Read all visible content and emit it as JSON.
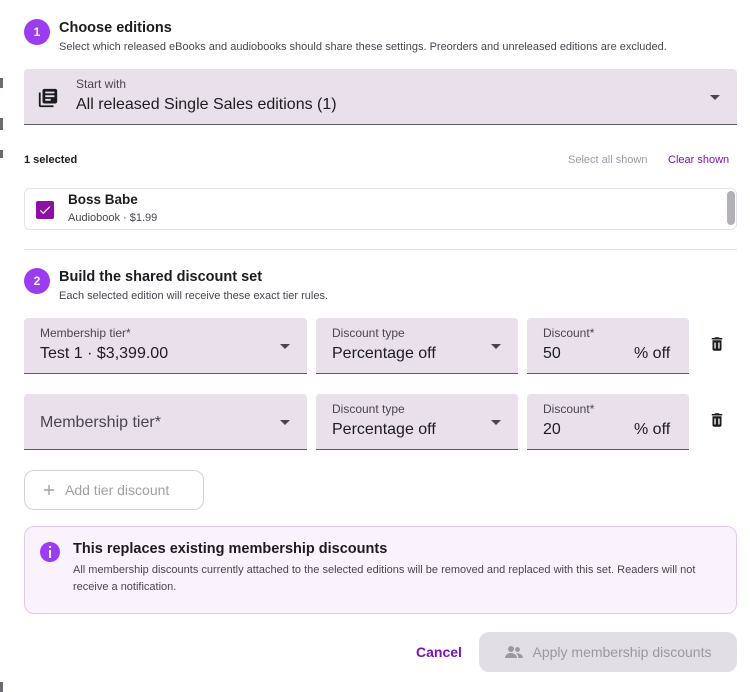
{
  "colors": {
    "accent": "#9c3cf0",
    "checkbox": "#8d0fa3",
    "link": "#7a12b8",
    "field_bg": "#e9e0eb",
    "info_bg": "#faf3fd"
  },
  "step1": {
    "number": "1",
    "title": "Choose editions",
    "description": "Select which released eBooks and audiobooks should share these settings. Preorders and unreleased editions are excluded."
  },
  "start_with": {
    "label": "Start with",
    "value": "All released Single Sales editions (1)",
    "icon": "library-books-icon"
  },
  "selection": {
    "count_text": "1 selected",
    "select_all": "Select all shown",
    "clear": "Clear shown"
  },
  "editions": [
    {
      "title": "Boss Babe",
      "meta": "Audiobook · $1.99",
      "checked": true
    }
  ],
  "step2": {
    "number": "2",
    "title": "Build the shared discount set",
    "description": "Each selected edition will receive these exact tier rules."
  },
  "tiers": [
    {
      "tier_label": "Membership tier*",
      "tier_value": "Test 1 · $3,399.00",
      "type_label": "Discount type",
      "type_value": "Percentage off",
      "discount_label": "Discount*",
      "discount_value": "50",
      "suffix": "% off"
    },
    {
      "tier_placeholder": "Membership tier*",
      "type_label": "Discount type",
      "type_value": "Percentage off",
      "discount_label": "Discount*",
      "discount_value": "20",
      "suffix": "% off"
    }
  ],
  "add_tier": {
    "label": "Add tier discount",
    "icon": "plus-icon"
  },
  "notice": {
    "title": "This replaces existing membership discounts",
    "body": "All membership discounts currently attached to the selected editions will be removed and replaced with this set. Readers will not receive a notification.",
    "icon": "info-icon"
  },
  "actions": {
    "cancel": "Cancel",
    "apply": "Apply membership discounts",
    "apply_icon": "group-icon"
  }
}
